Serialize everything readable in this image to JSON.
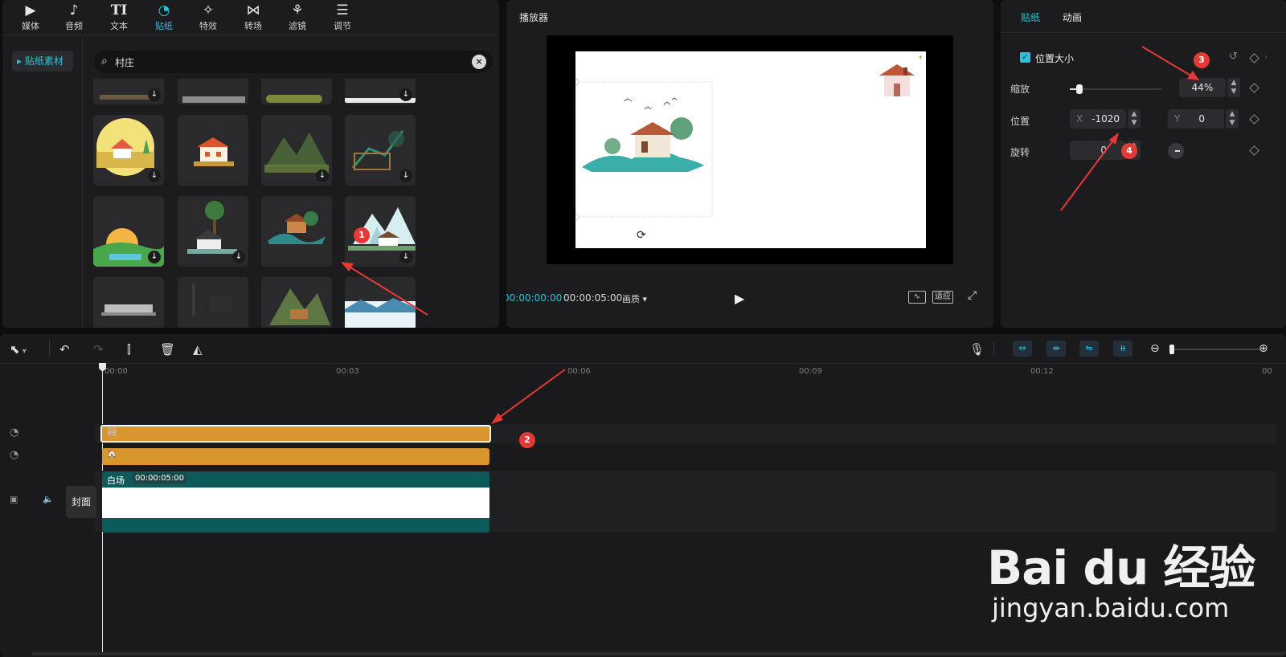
{
  "toolbar": {
    "tabs": [
      {
        "label": "媒体",
        "icon": "media-icon"
      },
      {
        "label": "音频",
        "icon": "audio-icon"
      },
      {
        "label": "文本",
        "icon": "text-icon"
      },
      {
        "label": "贴纸",
        "icon": "sticker-icon",
        "active": true
      },
      {
        "label": "特效",
        "icon": "effects-icon"
      },
      {
        "label": "转场",
        "icon": "transition-icon"
      },
      {
        "label": "滤镜",
        "icon": "filter-icon"
      },
      {
        "label": "调节",
        "icon": "adjust-icon"
      }
    ]
  },
  "library": {
    "sidebar_item": "▸ 贴纸素材",
    "search_value": "村庄"
  },
  "player": {
    "title": "播放器",
    "current_time": "00:00:00:00",
    "total_time": "00:00:05:00",
    "quality_label": "画质",
    "fit_label": "适应"
  },
  "props": {
    "tab_sticker": "贴纸",
    "tab_animation": "动画",
    "section_label": "位置大小",
    "scale_label": "缩放",
    "scale_value": "44%",
    "position_label": "位置",
    "x_label": "X",
    "x_value": "-1020",
    "y_label": "Y",
    "y_value": "0",
    "rotate_label": "旋转",
    "rotate_value": "0"
  },
  "timeline": {
    "ruler_ticks": [
      "00:00",
      "00:03",
      "00:06",
      "00:09",
      "00:12",
      "00"
    ],
    "main_track": {
      "clip_name": "白场",
      "clip_duration": "00:00:05:00",
      "cover_label": "封面"
    }
  },
  "annotations": [
    "1",
    "2",
    "3",
    "4"
  ],
  "watermark": {
    "brand": "Bai du 经验",
    "url": "jingyan.baidu.com"
  },
  "colors": {
    "accent": "#2bc4d6",
    "sticker_clip": "#d9962e",
    "main_clip": "#0d5a5a",
    "annotation": "#e53935"
  }
}
